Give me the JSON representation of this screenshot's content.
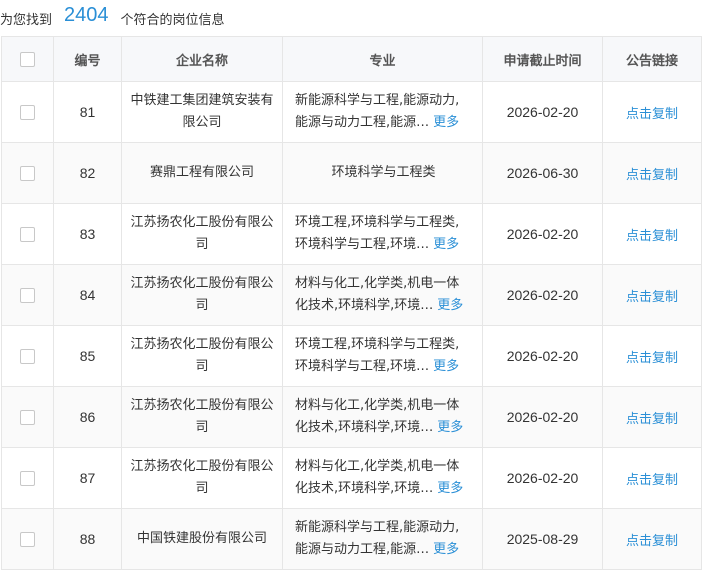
{
  "summary": {
    "prefix": "为您找到",
    "count": "2404",
    "suffix": "个符合的岗位信息"
  },
  "table": {
    "headers": {
      "number": "编号",
      "company": "企业名称",
      "major": "专业",
      "deadline": "申请截止时间",
      "link": "公告链接"
    },
    "more_label": "更多",
    "link_label": "点击复制",
    "rows": [
      {
        "number": "81",
        "company": "中铁建工集团建筑安装有限公司",
        "major": "新能源科学与工程,能源动力,能源与动力工程,能源…",
        "deadline": "2026-02-20",
        "has_more": true
      },
      {
        "number": "82",
        "company": "赛鼎工程有限公司",
        "major": "环境科学与工程类",
        "deadline": "2026-06-30",
        "has_more": false
      },
      {
        "number": "83",
        "company": "江苏扬农化工股份有限公司",
        "major": "环境工程,环境科学与工程类,环境科学与工程,环境…",
        "deadline": "2026-02-20",
        "has_more": true
      },
      {
        "number": "84",
        "company": "江苏扬农化工股份有限公司",
        "major": "材料与化工,化学类,机电一体化技术,环境科学,环境…",
        "deadline": "2026-02-20",
        "has_more": true
      },
      {
        "number": "85",
        "company": "江苏扬农化工股份有限公司",
        "major": "环境工程,环境科学与工程类,环境科学与工程,环境…",
        "deadline": "2026-02-20",
        "has_more": true
      },
      {
        "number": "86",
        "company": "江苏扬农化工股份有限公司",
        "major": "材料与化工,化学类,机电一体化技术,环境科学,环境…",
        "deadline": "2026-02-20",
        "has_more": true
      },
      {
        "number": "87",
        "company": "江苏扬农化工股份有限公司",
        "major": "材料与化工,化学类,机电一体化技术,环境科学,环境…",
        "deadline": "2026-02-20",
        "has_more": true
      },
      {
        "number": "88",
        "company": "中国铁建股份有限公司",
        "major": "新能源科学与工程,能源动力,能源与动力工程,能源…",
        "deadline": "2025-08-29",
        "has_more": true
      }
    ]
  },
  "colors": {
    "accent": "#2a8fd6",
    "header_bg": "#f7f8fa",
    "border": "#e6e6e6"
  }
}
